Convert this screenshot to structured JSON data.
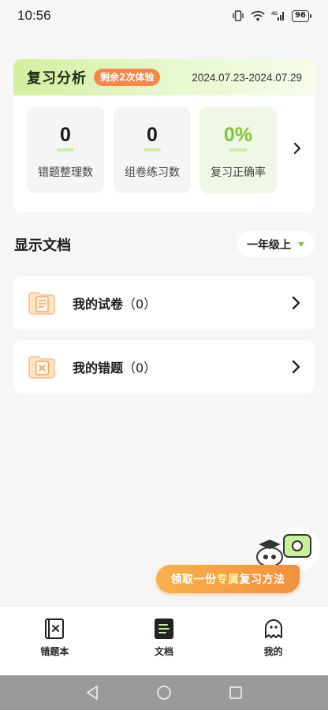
{
  "status_bar": {
    "time": "10:56",
    "battery": "96"
  },
  "review": {
    "title": "复习分析",
    "badge": "剩余2次体验",
    "date_range": "2024.07.23-2024.07.29",
    "stats": [
      {
        "value": "0",
        "label": "错题整理数"
      },
      {
        "value": "0",
        "label": "组卷练习数"
      },
      {
        "value": "0%",
        "label": "复习正确率"
      }
    ]
  },
  "documents": {
    "title": "显示文档",
    "grade": "一年级上",
    "items": [
      {
        "label": "我的试卷",
        "count": "（0）"
      },
      {
        "label": "我的错题",
        "count": "（0）"
      }
    ]
  },
  "promo": {
    "part1": "领取一份",
    "highlight": "专属",
    "part2": "复习方法"
  },
  "bottom_nav": [
    {
      "label": "错题本",
      "icon": "wrong-book-icon"
    },
    {
      "label": "文档",
      "icon": "document-icon"
    },
    {
      "label": "我的",
      "icon": "profile-icon"
    }
  ],
  "colors": {
    "accent_green": "#7fc733",
    "badge_orange": "#f7874a",
    "promo_orange": "#f48f3c"
  }
}
